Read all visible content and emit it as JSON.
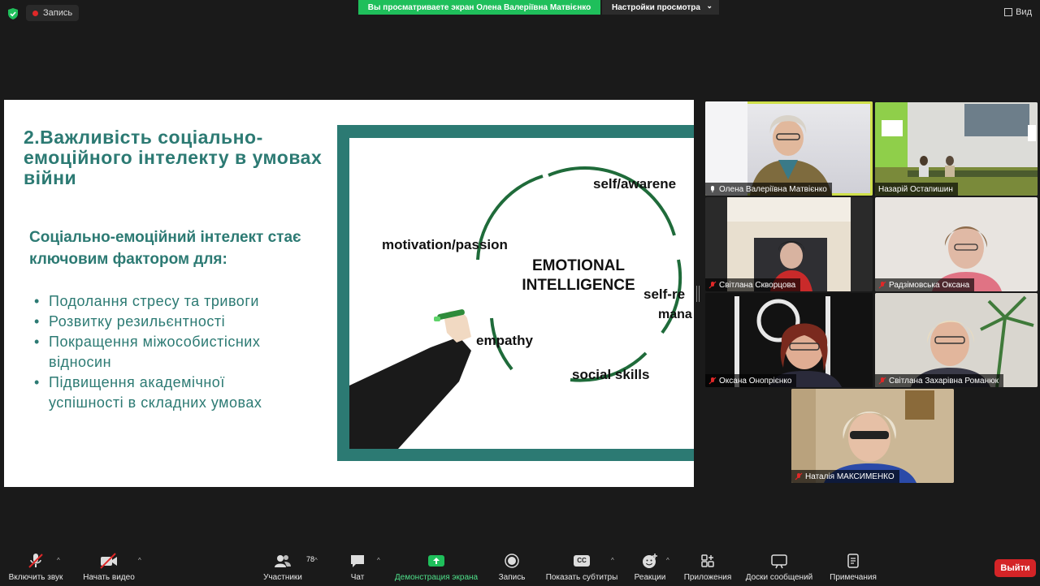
{
  "topbar": {
    "recording_label": "Запись",
    "share_banner": "Вы просматриваете экран Олена Валеріївна Матвієнко",
    "view_settings": "Настройки просмотра",
    "view_button": "Вид"
  },
  "slide": {
    "title": "2.Важливість соціально-емоційного інтелекту в умовах війни",
    "subtitle": "Соціально-емоційний інтелект стає ключовим фактором для:",
    "bullets": [
      "Подолання стресу та тривоги",
      "Розвитку резильєнтності",
      "Покращення міжособистісних відносин",
      "Підвищення академічної успішності в складних умовах"
    ],
    "diagram": {
      "center_line1": "EMOTIONAL",
      "center_line2": "INTELLIGENCE",
      "labels": [
        "self/awarene",
        "self-re",
        "mana",
        "social skills",
        "empathy",
        "motivation/passion"
      ]
    }
  },
  "participants": [
    {
      "name": "Олена Валеріївна Матвієнко",
      "active": true,
      "muted": false
    },
    {
      "name": "Назарій Остапишин",
      "active": false,
      "muted": false
    },
    {
      "name": "Світлана Скворцова",
      "active": false,
      "muted": true
    },
    {
      "name": "Радзімовська Оксана",
      "active": false,
      "muted": true
    },
    {
      "name": "Оксана Онопрієнко",
      "active": false,
      "muted": true
    },
    {
      "name": "Світлана Захарівна Романюк",
      "active": false,
      "muted": true
    },
    {
      "name": "Наталія МАКСИМЕНКО",
      "active": false,
      "muted": true
    }
  ],
  "toolbar": {
    "unmute": "Включить звук",
    "video": "Начать видео",
    "participants": "Участники",
    "participants_count": "78",
    "chat": "Чат",
    "share": "Демонстрация экрана",
    "record": "Запись",
    "captions": "Показать субтитры",
    "captions_icon_text": "CC",
    "reactions": "Реакции",
    "apps": "Приложения",
    "whiteboards": "Доски сообщений",
    "notes": "Примечания",
    "leave": "Выйти"
  },
  "colors": {
    "slide_teal": "#2c7a73",
    "share_green": "#1fbf5b",
    "leave_red": "#d42427",
    "active_speaker": "#cfe04a"
  }
}
